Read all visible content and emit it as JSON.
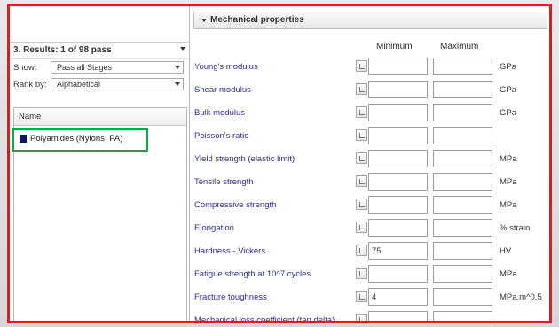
{
  "left": {
    "results_title": "3. Results: 1 of 98 pass",
    "show_label": "Show:",
    "show_value": "Pass all Stages",
    "rank_label": "Rank by:",
    "rank_value": "Alphabetical",
    "list_header": "Name",
    "items": [
      {
        "label": "Polyamides (Nylons, PA)",
        "color": "#10145a"
      }
    ]
  },
  "right": {
    "section_title": "Mechanical properties",
    "col_min": "Minimum",
    "col_max": "Maximum",
    "rows": [
      {
        "name": "Young's modulus",
        "min": "",
        "max": "",
        "unit": "GPa"
      },
      {
        "name": "Shear modulus",
        "min": "",
        "max": "",
        "unit": "GPa"
      },
      {
        "name": "Bulk modulus",
        "min": "",
        "max": "",
        "unit": "GPa"
      },
      {
        "name": "Poisson's ratio",
        "min": "",
        "max": "",
        "unit": ""
      },
      {
        "name": "Yield strength (elastic limit)",
        "min": "",
        "max": "",
        "unit": "MPa"
      },
      {
        "name": "Tensile strength",
        "min": "",
        "max": "",
        "unit": "MPa"
      },
      {
        "name": "Compressive strength",
        "min": "",
        "max": "",
        "unit": "MPa"
      },
      {
        "name": "Elongation",
        "min": "",
        "max": "",
        "unit": "% strain"
      },
      {
        "name": "Hardness - Vickers",
        "min": "75",
        "max": "",
        "unit": "HV"
      },
      {
        "name": "Fatigue strength at 10^7 cycles",
        "min": "",
        "max": "",
        "unit": "MPa"
      },
      {
        "name": "Fracture toughness",
        "min": "4",
        "max": "",
        "unit": "MPa.m^0.5"
      },
      {
        "name": "Mechanical loss coefficient (tan delta)",
        "min": "",
        "max": "",
        "unit": ""
      }
    ]
  },
  "colors": {
    "frame": "#c4262b",
    "highlight": "#1aa34a",
    "link": "#2a2aa8"
  }
}
